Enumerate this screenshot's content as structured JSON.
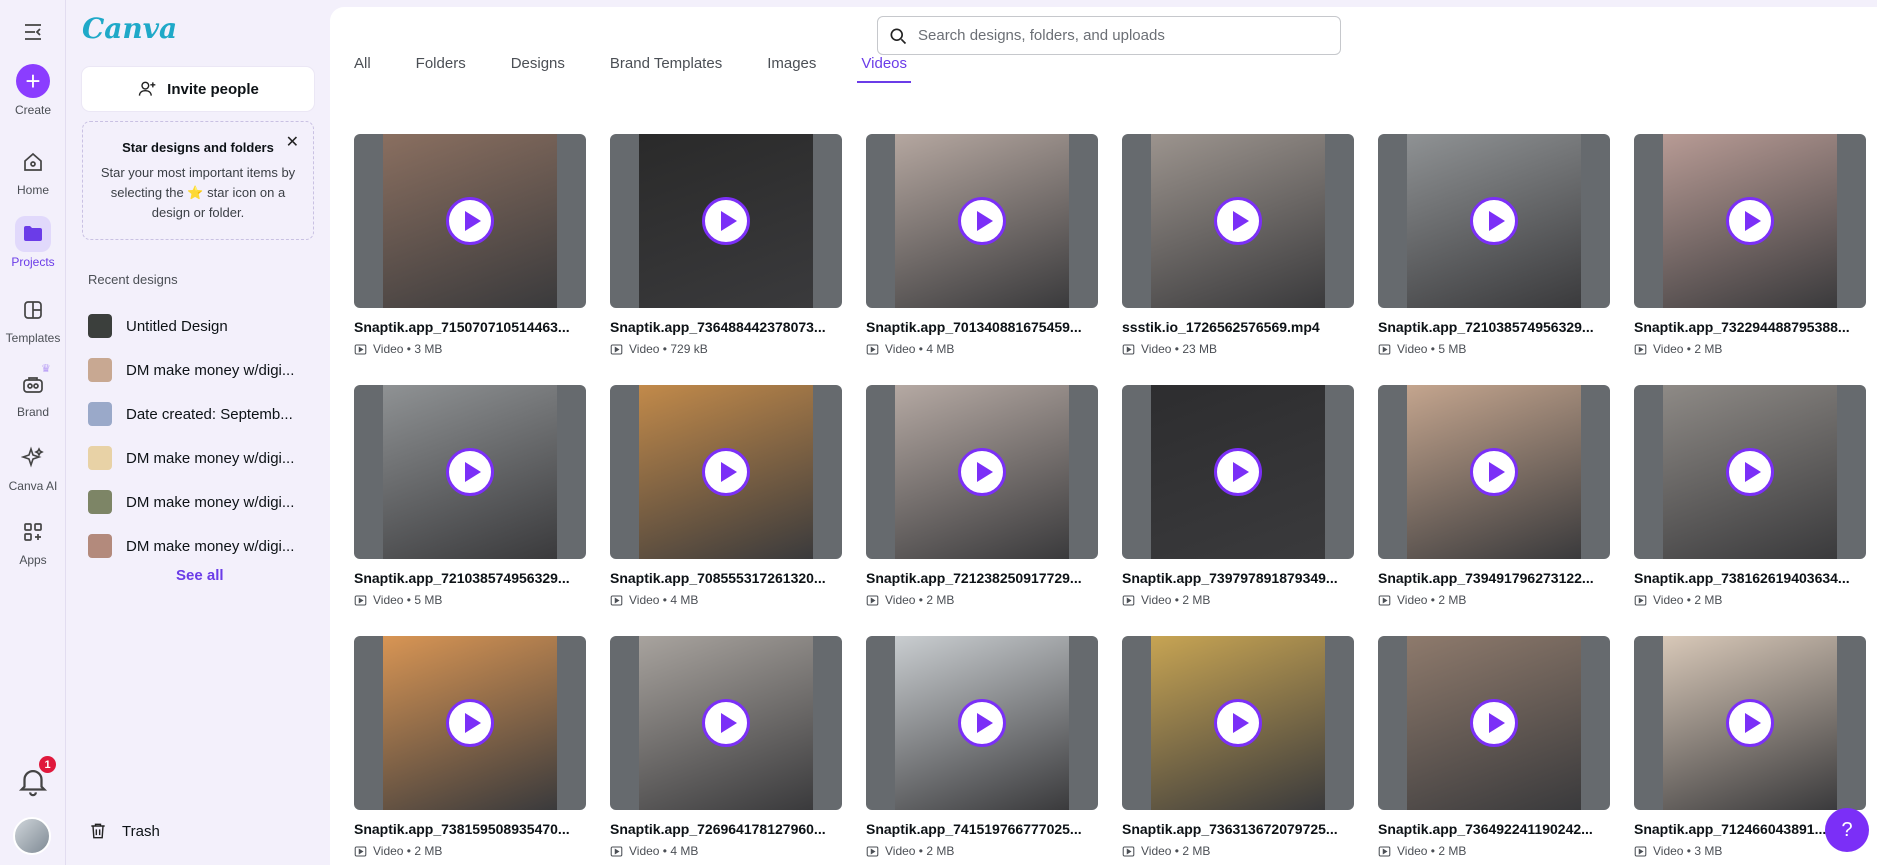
{
  "rail": {
    "create": "Create",
    "home": "Home",
    "projects": "Projects",
    "templates": "Templates",
    "brand": "Brand",
    "canva_ai": "Canva AI",
    "apps": "Apps",
    "notification_count": "1"
  },
  "panel": {
    "logo": "Canva",
    "invite": "Invite people",
    "star_title": "Star designs and folders",
    "star_text": "Star your most important items by selecting the ⭐ star icon on a design or folder.",
    "recent_title": "Recent designs",
    "recent": [
      {
        "label": "Untitled Design",
        "color": "#3b3f3c"
      },
      {
        "label": "DM make money w/digi...",
        "color": "#c8a892"
      },
      {
        "label": "Date created: Septemb...",
        "color": "#9aa9c9"
      },
      {
        "label": "DM make money w/digi...",
        "color": "#e8d2a6"
      },
      {
        "label": "DM make money w/digi...",
        "color": "#7d8566"
      },
      {
        "label": "DM make money w/digi...",
        "color": "#b38a7c"
      }
    ],
    "see_all": "See all",
    "trash": "Trash"
  },
  "search": {
    "placeholder": "Search designs, folders, and uploads"
  },
  "tabs": [
    "All",
    "Folders",
    "Designs",
    "Brand Templates",
    "Images",
    "Videos"
  ],
  "active_tab": "Videos",
  "videos": [
    {
      "title": "Snaptik.app_715070710514463...",
      "meta": "Video • 3 MB",
      "tone": "#8a6f60"
    },
    {
      "title": "Snaptik.app_736488442378073...",
      "meta": "Video • 729 kB",
      "tone": "#2a2a2a"
    },
    {
      "title": "Snaptik.app_701340881675459...",
      "meta": "Video • 4 MB",
      "tone": "#b5a7a0"
    },
    {
      "title": "ssstik.io_1726562576569.mp4",
      "meta": "Video • 23 MB",
      "tone": "#9c948e"
    },
    {
      "title": "Snaptik.app_721038574956329...",
      "meta": "Video • 5 MB",
      "tone": "#8f9294"
    },
    {
      "title": "Snaptik.app_732294488795388...",
      "meta": "Video • 2 MB",
      "tone": "#b89b95"
    },
    {
      "title": "Snaptik.app_721038574956329...",
      "meta": "Video • 5 MB",
      "tone": "#8f9294"
    },
    {
      "title": "Snaptik.app_708555317261320...",
      "meta": "Video • 4 MB",
      "tone": "#c28a4a"
    },
    {
      "title": "Snaptik.app_721238250917729...",
      "meta": "Video • 2 MB",
      "tone": "#b5a9a3"
    },
    {
      "title": "Snaptik.app_739797891879349...",
      "meta": "Video • 2 MB",
      "tone": "#2d2d2f"
    },
    {
      "title": "Snaptik.app_739491796273122...",
      "meta": "Video • 2 MB",
      "tone": "#c4a58e"
    },
    {
      "title": "Snaptik.app_738162619403634...",
      "meta": "Video • 2 MB",
      "tone": "#8e8a86"
    },
    {
      "title": "Snaptik.app_738159508935470...",
      "meta": "Video • 2 MB",
      "tone": "#d89554"
    },
    {
      "title": "Snaptik.app_726964178127960...",
      "meta": "Video • 4 MB",
      "tone": "#a8a39e"
    },
    {
      "title": "Snaptik.app_741519766777025...",
      "meta": "Video • 2 MB",
      "tone": "#c9cdd0"
    },
    {
      "title": "Snaptik.app_736313672079725...",
      "meta": "Video • 2 MB",
      "tone": "#c7a453"
    },
    {
      "title": "Snaptik.app_736492241190242...",
      "meta": "Video • 2 MB",
      "tone": "#8e7a6c"
    },
    {
      "title": "Snaptik.app_712466043891...",
      "meta": "Video • 3 MB",
      "tone": "#d8c8b8"
    }
  ],
  "help": "?",
  "colors": {
    "accent": "#8b3dff",
    "accent_text": "#6b3ce8"
  }
}
